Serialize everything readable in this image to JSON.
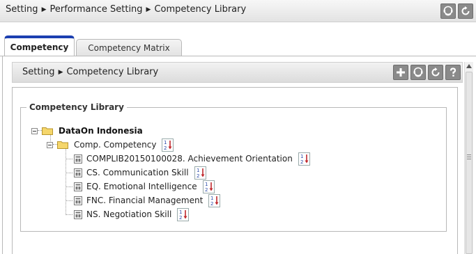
{
  "header": {
    "breadcrumb": [
      "Setting",
      "Performance Setting",
      "Competency Library"
    ],
    "icons": [
      "support-icon",
      "refresh-icon"
    ]
  },
  "tabs": [
    {
      "label": "Competency",
      "active": true
    },
    {
      "label": "Competency Matrix",
      "active": false
    }
  ],
  "subheader": {
    "breadcrumb": [
      "Setting",
      "Competency Library"
    ],
    "icons": [
      "add-icon",
      "support-icon",
      "refresh-icon",
      "help-icon"
    ]
  },
  "library": {
    "legend": "Competency Library",
    "root": "DataOn Indonesia",
    "group": "Comp. Competency",
    "items": [
      "COMPLIB20150100028. Achievement Orientation",
      "CS. Communication Skill",
      "EQ. Emotional Intelligence",
      "FNC. Financial Management",
      "NS. Negotiation Skill"
    ]
  },
  "colors": {
    "tab_accent": "#1c3fb0",
    "icon_button": "#8a8a8a"
  }
}
